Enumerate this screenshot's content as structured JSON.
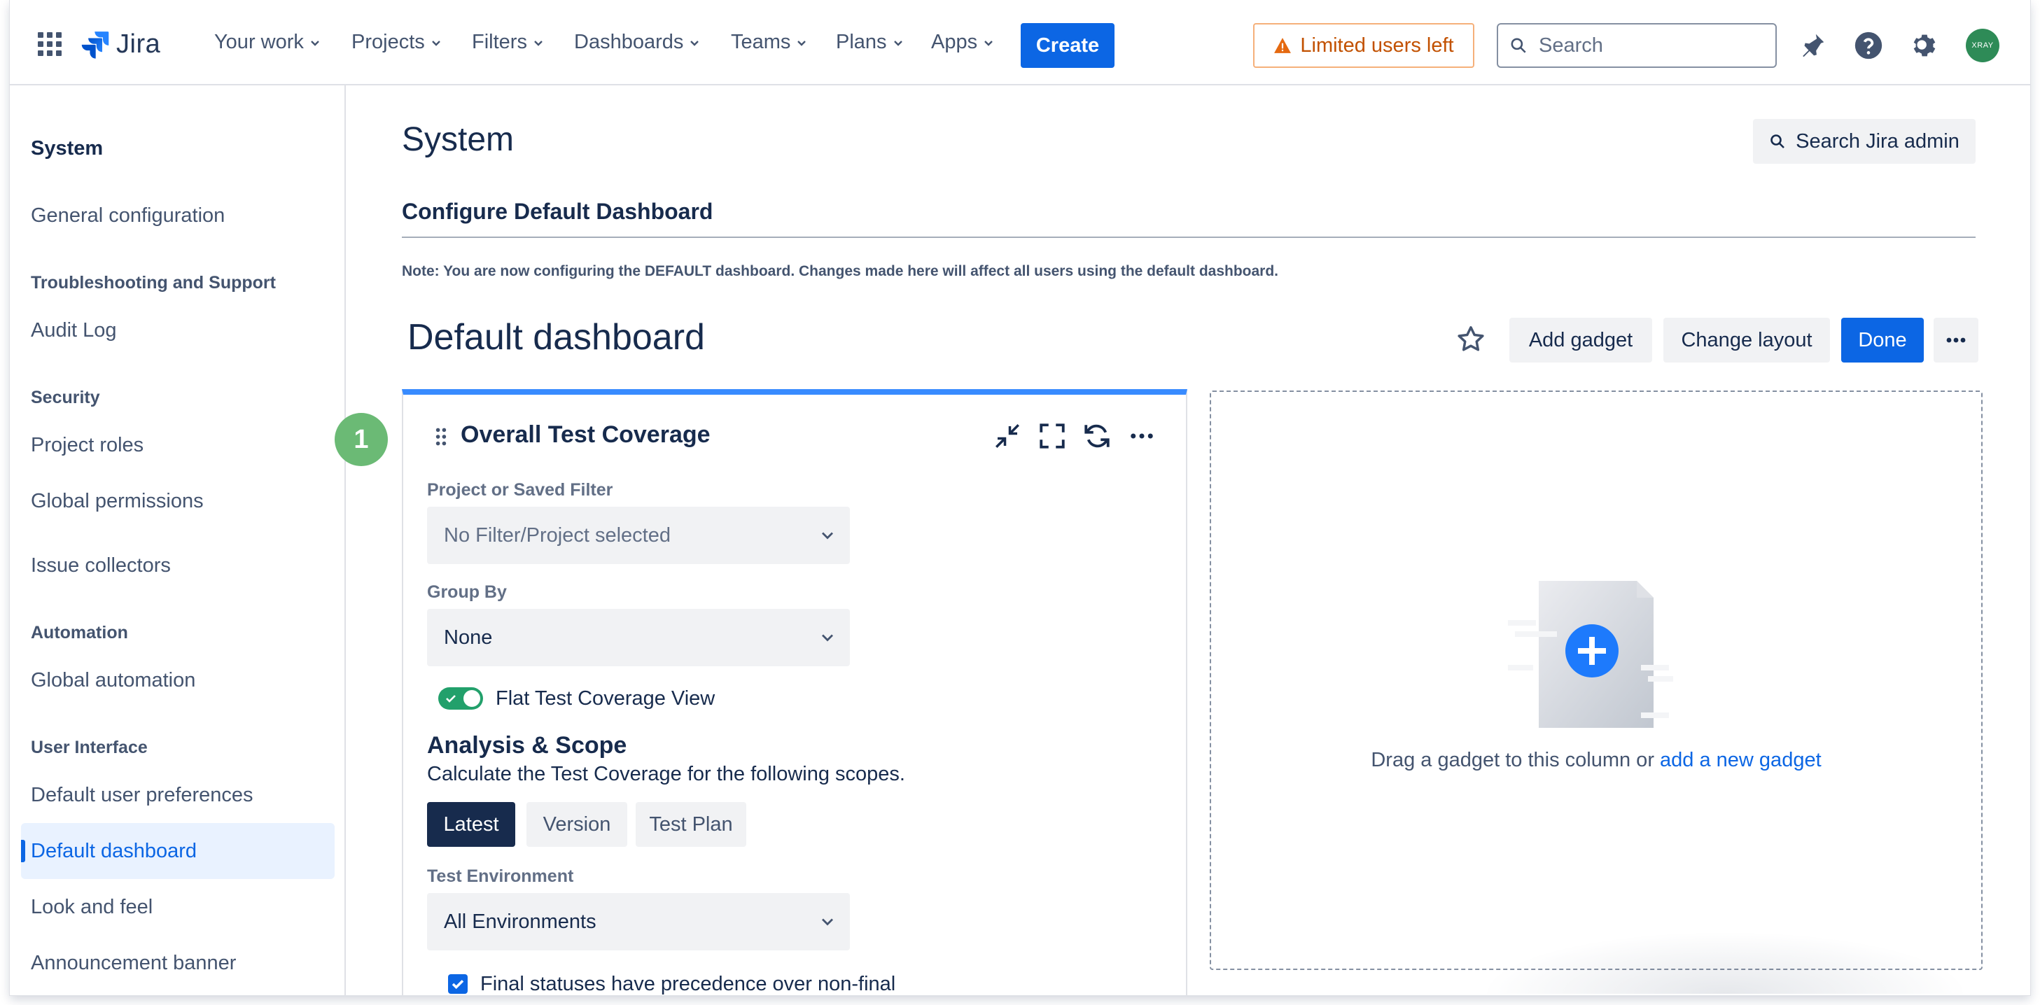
{
  "topnav": {
    "logo_text": "Jira",
    "items": [
      {
        "label": "Your work"
      },
      {
        "label": "Projects"
      },
      {
        "label": "Filters"
      },
      {
        "label": "Dashboards"
      },
      {
        "label": "Teams"
      },
      {
        "label": "Plans"
      },
      {
        "label": "Apps"
      }
    ],
    "create_label": "Create",
    "limited_label": "Limited users left",
    "search_placeholder": "Search",
    "avatar_text": "XRAY",
    "accent_color": "#0C66E4"
  },
  "sidebar": {
    "title": "System",
    "entries": [
      {
        "type": "item",
        "label": "General configuration"
      },
      {
        "type": "section",
        "label": "Troubleshooting and Support"
      },
      {
        "type": "item",
        "label": "Audit Log"
      },
      {
        "type": "section",
        "label": "Security"
      },
      {
        "type": "item",
        "label": "Project roles"
      },
      {
        "type": "item",
        "label": "Global permissions"
      },
      {
        "type": "item",
        "label": "Issue collectors"
      },
      {
        "type": "section",
        "label": "Automation"
      },
      {
        "type": "item",
        "label": "Global automation"
      },
      {
        "type": "section",
        "label": "User Interface"
      },
      {
        "type": "item",
        "label": "Default user preferences"
      },
      {
        "type": "item",
        "label": "Default dashboard",
        "active": true
      },
      {
        "type": "item",
        "label": "Look and feel"
      },
      {
        "type": "item",
        "label": "Announcement banner"
      }
    ]
  },
  "main": {
    "page_title": "System",
    "admin_search_label": "Search Jira admin",
    "section_title": "Configure Default Dashboard",
    "note": "Note: You are now configuring the DEFAULT dashboard. Changes made here will affect all users using the default dashboard.",
    "dashboard_title": "Default dashboard",
    "add_gadget_label": "Add gadget",
    "change_layout_label": "Change layout",
    "done_label": "Done"
  },
  "gadget": {
    "badge": "1",
    "title": "Overall Test Coverage",
    "filter_label": "Project or Saved Filter",
    "filter_value": "No Filter/Project selected",
    "group_by_label": "Group By",
    "group_by_value": "None",
    "flat_view_label": "Flat Test Coverage View",
    "flat_view_on": true,
    "analysis_title": "Analysis & Scope",
    "analysis_desc": "Calculate the Test Coverage for the following scopes.",
    "scopes": [
      {
        "label": "Latest",
        "selected": true
      },
      {
        "label": "Version",
        "selected": false
      },
      {
        "label": "Test Plan",
        "selected": false
      }
    ],
    "environment_label": "Test Environment",
    "environment_value": "All Environments",
    "final_status_label": "Final statuses have precedence over non-final",
    "final_status_checked": true
  },
  "dropzone": {
    "text": "Drag a gadget to this column or",
    "link": "add a new gadget"
  }
}
